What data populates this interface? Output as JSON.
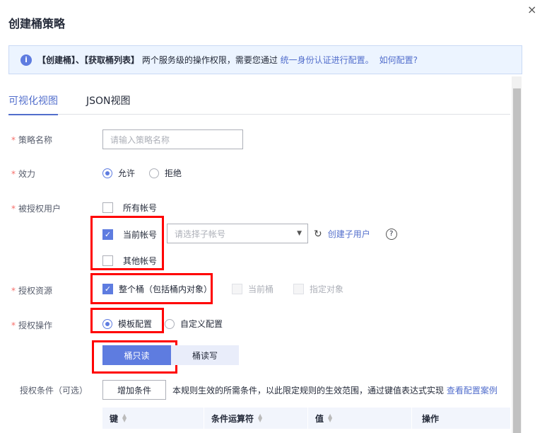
{
  "dialog": {
    "title": "创建桶策略",
    "close": "×"
  },
  "notice": {
    "text1": "【创建桶】、【获取桶列表】",
    "text2": " 两个服务级的操作权限，需要您通过 ",
    "link1": "统一身份认证进行配置。",
    "link2": "如何配置?"
  },
  "tabs": [
    {
      "label": "可视化视图"
    },
    {
      "label": "JSON视图"
    }
  ],
  "form": {
    "policy_name": {
      "label": "策略名称",
      "placeholder": "请输入策略名称"
    },
    "effect": {
      "label": "效力",
      "options": [
        "允许",
        "拒绝"
      ]
    },
    "principal": {
      "label": "被授权用户",
      "all": "所有帐号",
      "current": "当前帐号",
      "sub_placeholder": "请选择子帐号",
      "create_sub": "创建子用户",
      "other": "其他帐号"
    },
    "resource": {
      "label": "授权资源",
      "whole": "整个桶（包括桶内对象）",
      "current": "当前桶",
      "specified": "指定对象"
    },
    "action": {
      "label": "授权操作",
      "template": "模板配置",
      "custom": "自定义配置",
      "templates": [
        "桶只读",
        "桶读写"
      ]
    },
    "condition": {
      "label": "授权条件（可选）",
      "add": "增加条件",
      "desc": "本规则生效的所需条件，以此限定规则的生效范围，通过键值表达式实现 ",
      "link": "查看配置案例",
      "columns": [
        "键",
        "条件运算符",
        "值",
        "操作"
      ]
    }
  }
}
